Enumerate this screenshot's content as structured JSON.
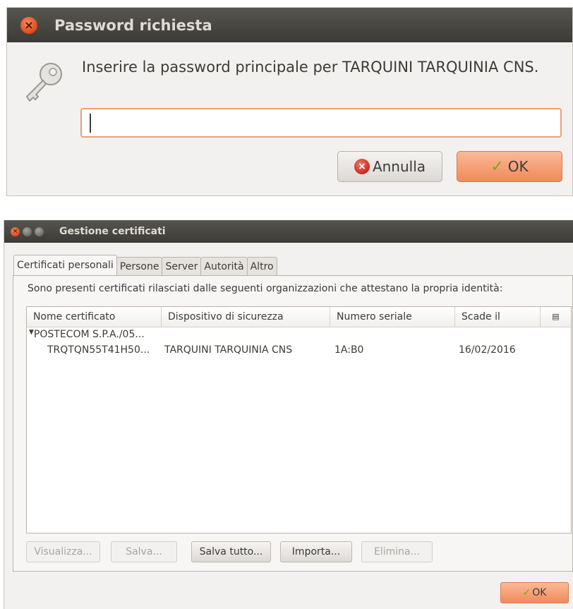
{
  "password_dialog": {
    "title": "Password richiesta",
    "prompt": "Inserire la password principale per TARQUINI TARQUINIA CNS.",
    "password_value": "",
    "cancel_label": "Annulla",
    "ok_label": "OK",
    "icon": "key-icon"
  },
  "cert_manager": {
    "title": "Gestione certificati",
    "tabs": [
      "Certificati personali",
      "Persone",
      "Server",
      "Autorità",
      "Altro"
    ],
    "description": "Sono presenti certificati rilasciati dalle seguenti organizzazioni che attestano la propria identità:",
    "columns": [
      "Nome certificato",
      "Dispositivo di sicurezza",
      "Numero seriale",
      "Scade il"
    ],
    "group": "POSTECOM S.P.A./05...",
    "certificate": {
      "name": "TRQTQN55T41H50...",
      "device": "TARQUINI TARQUINIA CNS",
      "serial": "1A:B0",
      "expires": "16/02/2016"
    },
    "buttons": {
      "view": "Visualizza...",
      "save": "Salva...",
      "save_all": "Salva tutto...",
      "import": "Importa...",
      "delete": "Elimina..."
    },
    "ok_label": "OK"
  },
  "colors": {
    "titlebar": "#3c3b37",
    "accent_orange": "#f08a5c",
    "background": "#f2f1f0"
  }
}
